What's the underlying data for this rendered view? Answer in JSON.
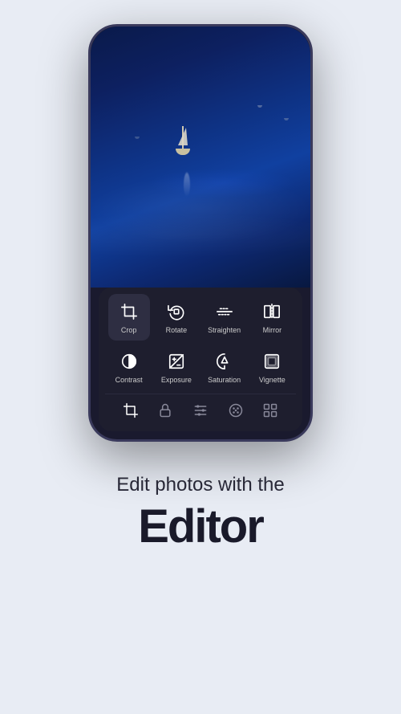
{
  "background_color": "#e8ecf4",
  "phone": {
    "tools_row1": [
      {
        "id": "crop",
        "label": "Crop",
        "active": true
      },
      {
        "id": "rotate",
        "label": "Rotate",
        "active": false
      },
      {
        "id": "straighten",
        "label": "Straighten",
        "active": false
      },
      {
        "id": "mirror",
        "label": "Mirror",
        "active": false
      }
    ],
    "tools_row2": [
      {
        "id": "contrast",
        "label": "Contrast",
        "active": false
      },
      {
        "id": "exposure",
        "label": "Exposure",
        "active": false
      },
      {
        "id": "saturation",
        "label": "Saturation",
        "active": false
      },
      {
        "id": "vignette",
        "label": "Vignette",
        "active": false
      }
    ],
    "bottom_icons": [
      "crop-bottom",
      "lock",
      "sliders",
      "palette",
      "grid"
    ]
  },
  "text": {
    "subtitle": "Edit photos with the",
    "main_title": "Editor"
  }
}
